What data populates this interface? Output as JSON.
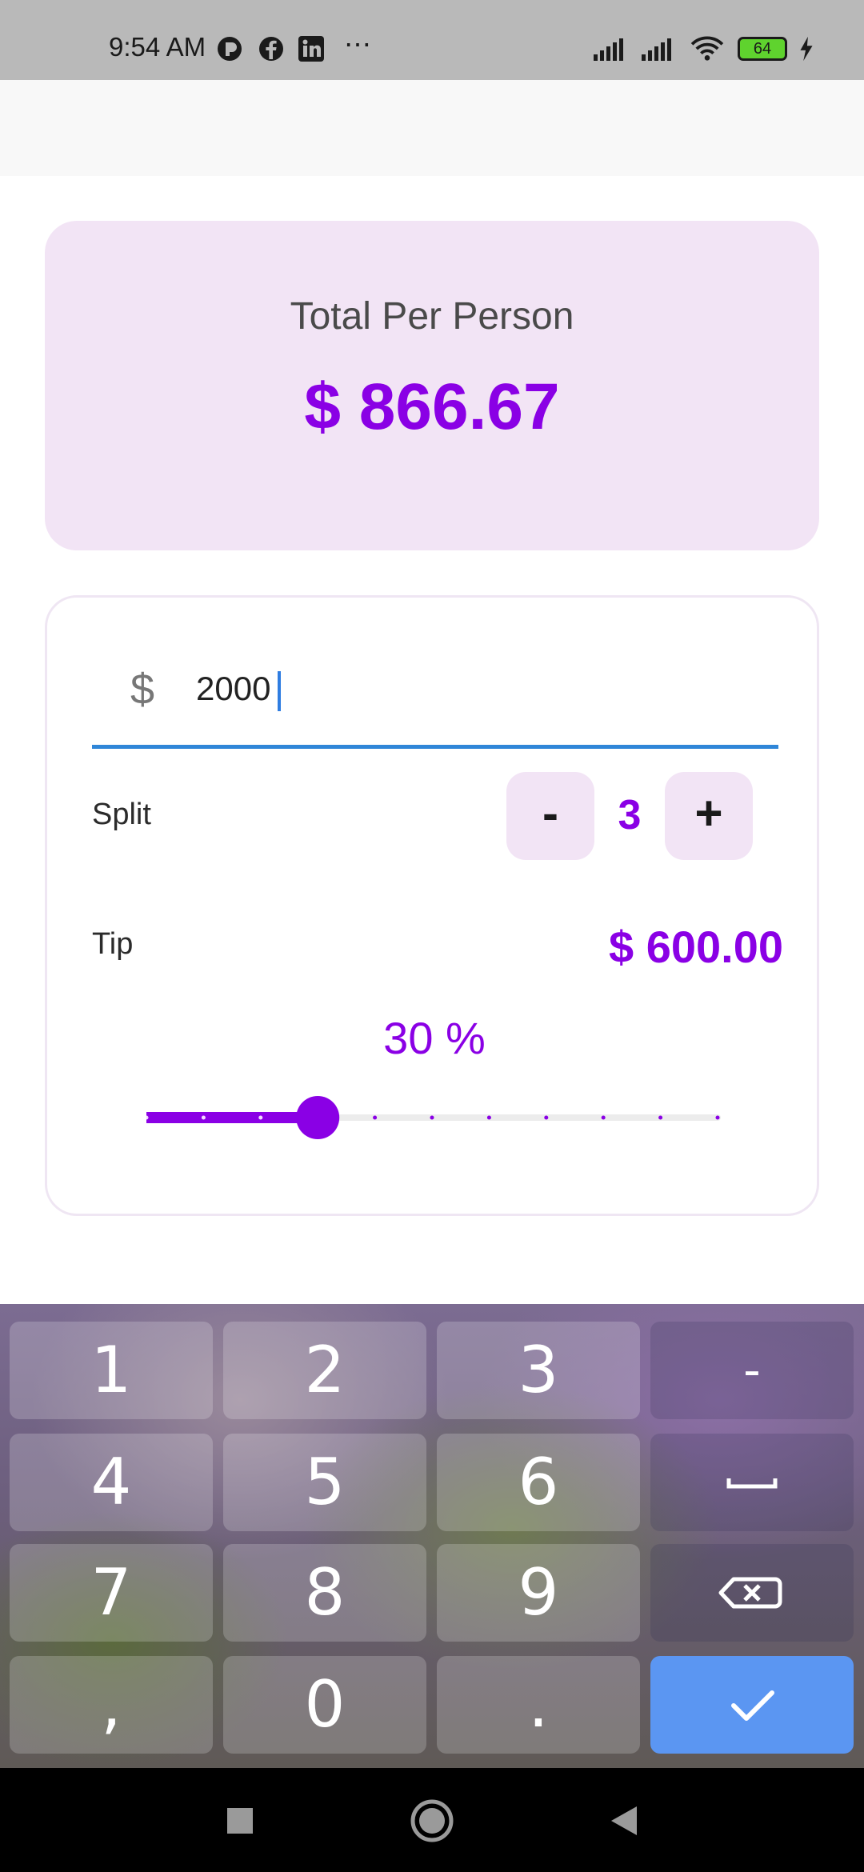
{
  "status_bar": {
    "time": "9:54 AM",
    "battery": "64",
    "icons": [
      "cast-icon",
      "facebook-icon",
      "linkedin-icon",
      "more-dots-icon",
      "signal-icon",
      "signal-icon",
      "wifi-icon",
      "battery-icon",
      "charging-icon"
    ]
  },
  "total": {
    "title": "Total Per Person",
    "amount": "$ 866.67"
  },
  "bill": {
    "prefix": "$",
    "value": "2000"
  },
  "split": {
    "label": "Split",
    "minus": "-",
    "value": "3",
    "plus": "+"
  },
  "tip": {
    "label": "Tip",
    "amount": "$ 600.00",
    "percent_label": "30 %",
    "slider_value_fraction": 0.3,
    "slider_divisions": 10
  },
  "colors": {
    "accent": "#8a00e5",
    "card_background": "#f2e4f5",
    "input_underline": "#2f86d8",
    "keyboard_done": "#5b96f2"
  },
  "keyboard": {
    "rows": [
      [
        "1",
        "2",
        "3",
        "-"
      ],
      [
        "4",
        "5",
        "6",
        "space-icon"
      ],
      [
        "7",
        "8",
        "9",
        "backspace-icon"
      ],
      [
        ",",
        "0",
        ".",
        "check-icon"
      ]
    ],
    "keys": {
      "k1": "1",
      "k2": "2",
      "k3": "3",
      "minus": "-",
      "k4": "4",
      "k5": "5",
      "k6": "6",
      "k7": "7",
      "k8": "8",
      "k9": "9",
      "comma": ",",
      "k0": "0",
      "dot": "."
    }
  },
  "nav_bar": {
    "buttons": [
      "recents-square-icon",
      "home-circle-icon",
      "back-triangle-icon"
    ]
  }
}
